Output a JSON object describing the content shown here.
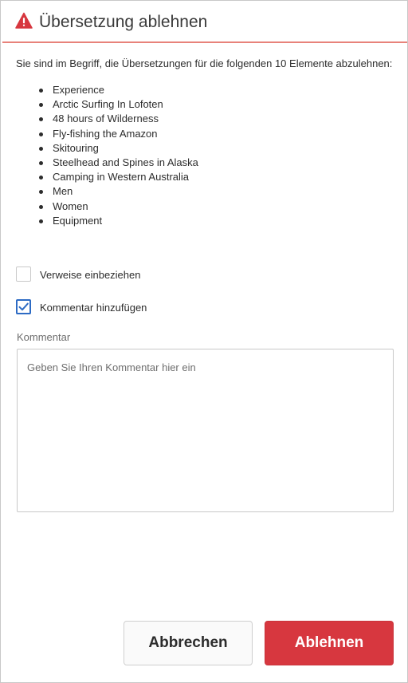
{
  "dialog": {
    "title": "Übersetzung ablehnen",
    "icon": "alert-triangle-icon",
    "accent_color": "#d7373f",
    "header_rule_color": "#e8827a"
  },
  "intro_text": "Sie sind im Begriff, die Übersetzungen für die folgenden 10 Elemente abzulehnen:",
  "items": [
    "Experience",
    "Arctic Surfing In Lofoten",
    "48 hours of Wilderness",
    "Fly-fishing the Amazon",
    "Skitouring",
    "Steelhead and Spines in Alaska",
    "Camping in Western Australia",
    "Men",
    "Women",
    "Equipment"
  ],
  "options": {
    "include_references": {
      "label": "Verweise einbeziehen",
      "checked": false
    },
    "add_comment": {
      "label": "Kommentar hinzufügen",
      "checked": true,
      "check_color": "#2d6bc4"
    }
  },
  "comment": {
    "label": "Kommentar",
    "value": "",
    "placeholder": "Geben Sie Ihren Kommentar hier ein"
  },
  "buttons": {
    "cancel_label": "Abbrechen",
    "confirm_label": "Ablehnen"
  }
}
